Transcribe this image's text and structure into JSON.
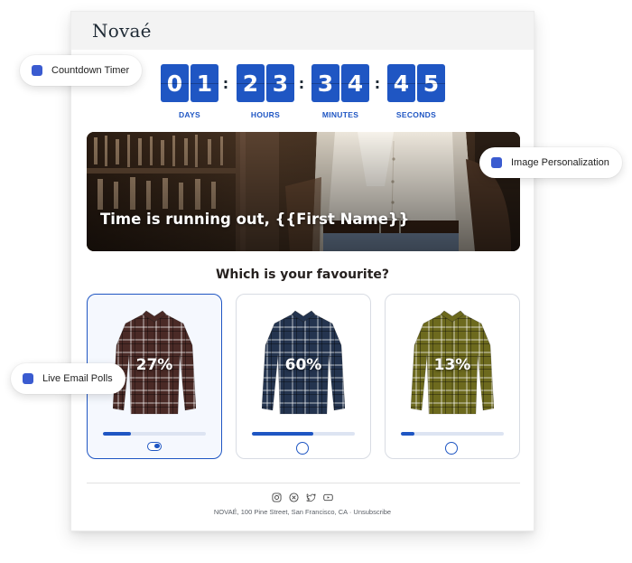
{
  "brand": "Novaé",
  "accent_color": "#1f56c3",
  "countdown": {
    "days": {
      "d1": "0",
      "d2": "1",
      "label": "DAYS"
    },
    "hours": {
      "d1": "2",
      "d2": "3",
      "label": "HOURS"
    },
    "minutes": {
      "d1": "3",
      "d2": "4",
      "label": "MINUTES"
    },
    "seconds": {
      "d1": "4",
      "d2": "5",
      "label": "SECONDS"
    },
    "separator": ":"
  },
  "banner": {
    "headline": "Time is running out, {{First Name}}"
  },
  "poll": {
    "question": "Which is your favourite?",
    "options": [
      {
        "percent_label": "27%",
        "percent": 27,
        "selected": true,
        "shirt_color": "#4a2a26"
      },
      {
        "percent_label": "60%",
        "percent": 60,
        "selected": false,
        "shirt_color": "#24344f"
      },
      {
        "percent_label": "13%",
        "percent": 13,
        "selected": false,
        "shirt_color": "#6d6a1e"
      }
    ]
  },
  "footer": {
    "social_icons": [
      "instagram-icon",
      "x-icon",
      "twitter-icon",
      "youtube-icon"
    ],
    "address": "NOVAÉ, 100 Pine Street, San Francisco, CA · Unsubscribe"
  },
  "callouts": {
    "countdown": "Countdown Timer",
    "personalization": "Image Personalization",
    "polls": "Live Email Polls",
    "dot_color": "#3a5bd0"
  }
}
